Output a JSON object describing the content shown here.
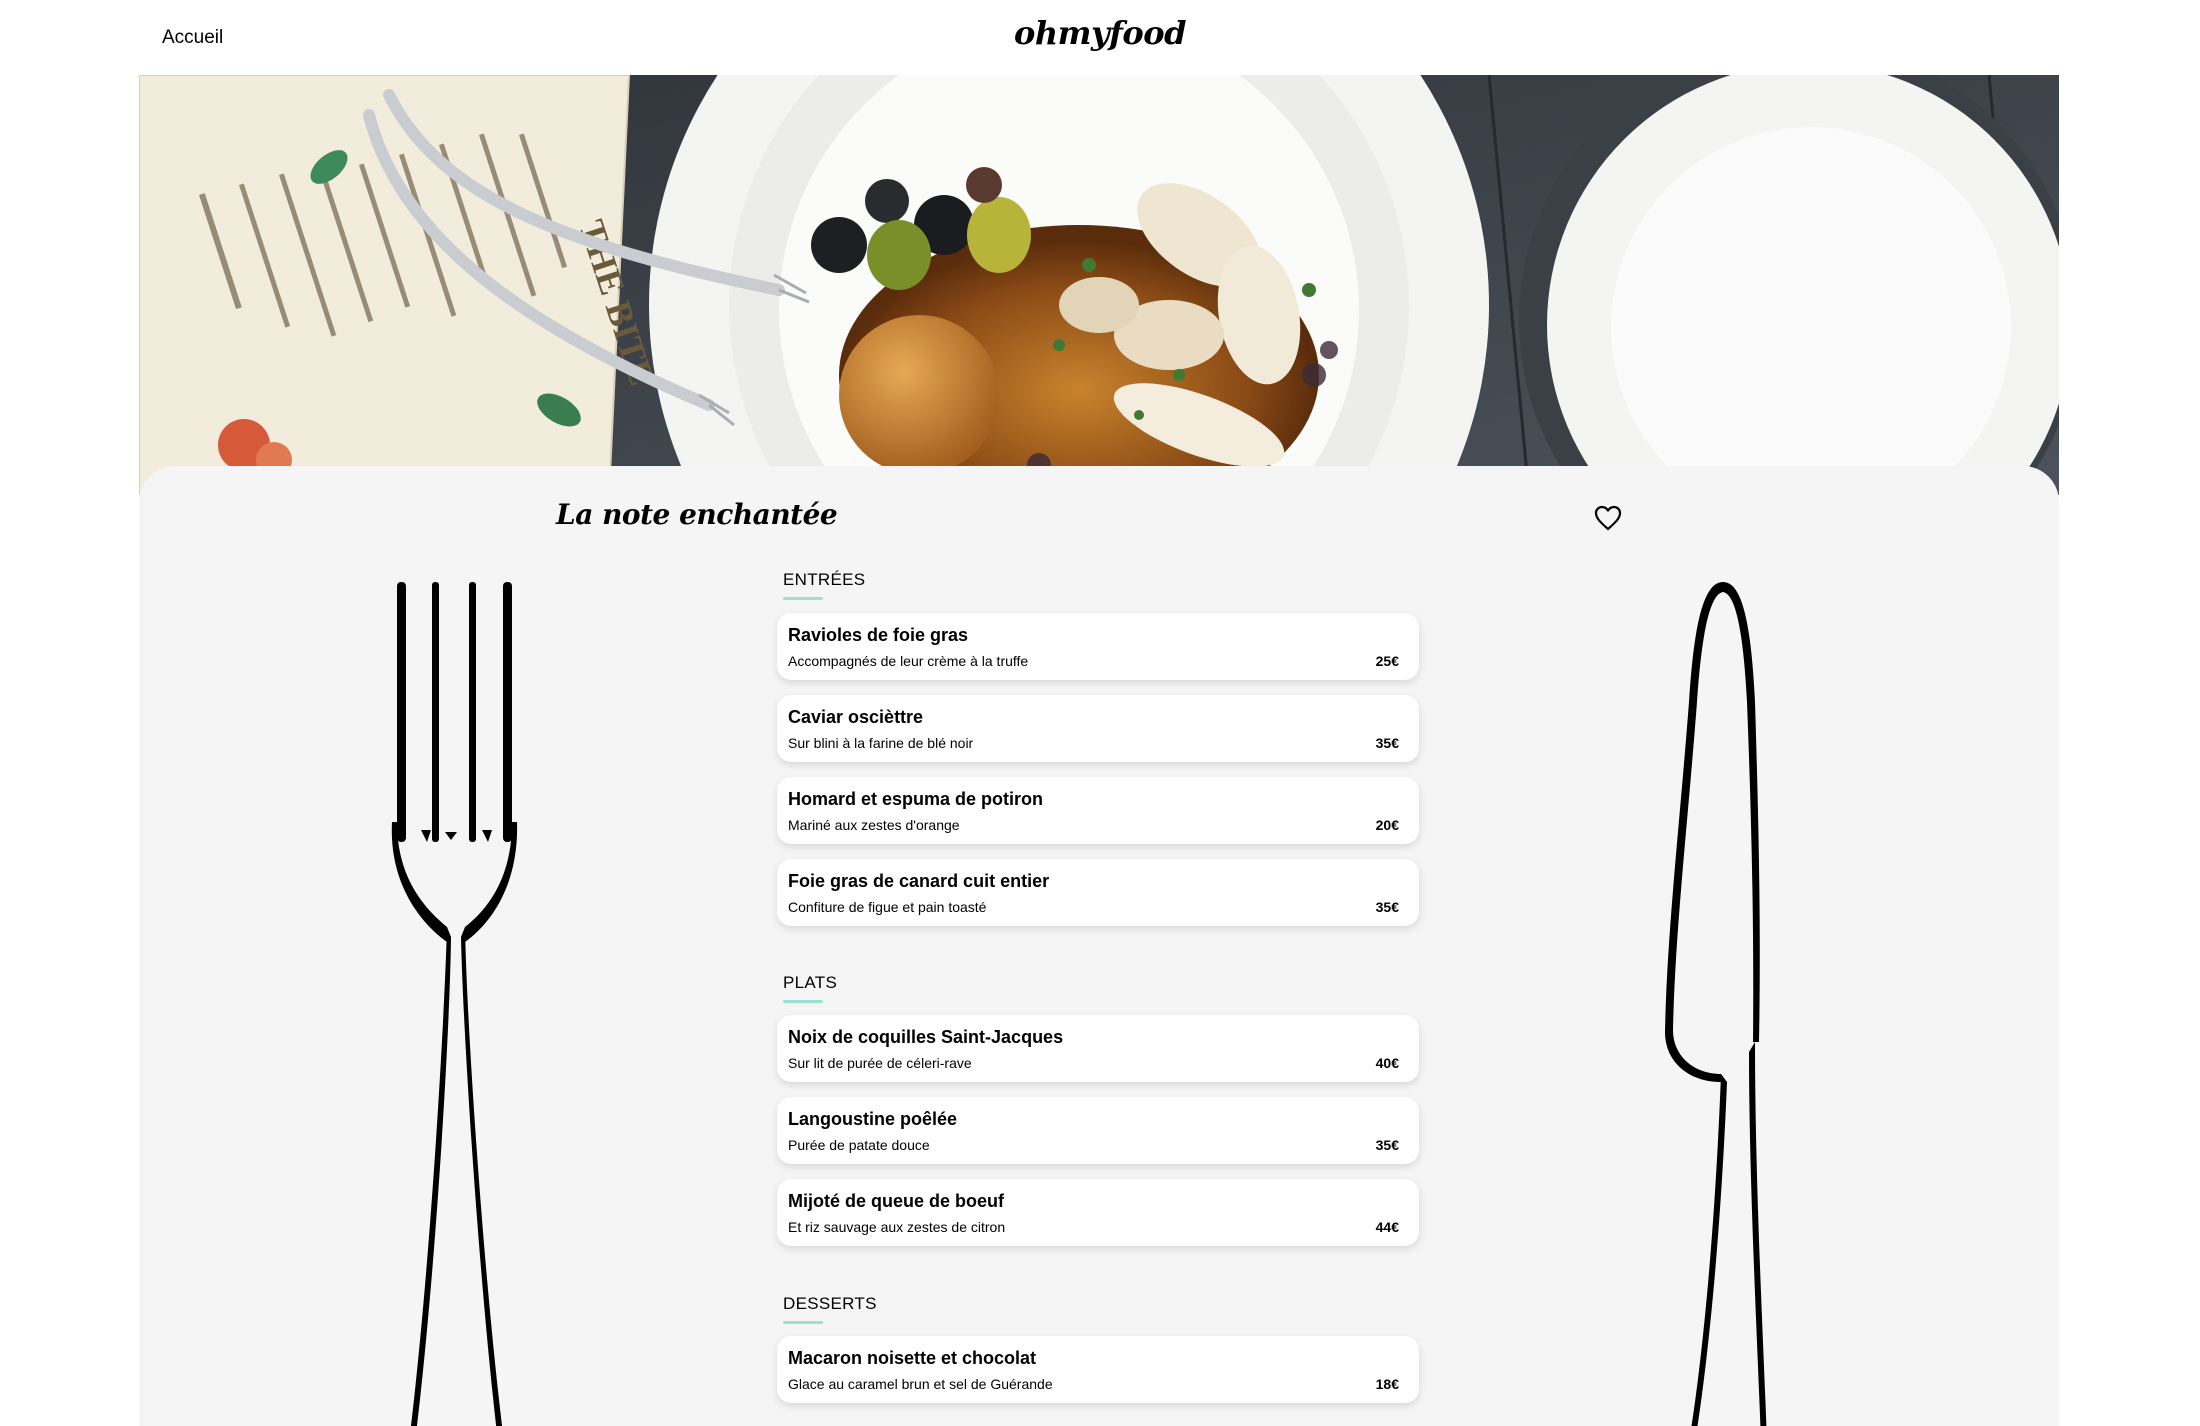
{
  "header": {
    "nav_home": "Accueil",
    "logo": "ohmyfood"
  },
  "hero": {
    "image_description": "Overhead photo of a plate with olives, arancini and grilled squid next to a menu and an empty plate",
    "menu_text": "THE BITE"
  },
  "restaurant": {
    "name": "La note enchantée",
    "favorite_icon": "heart-icon",
    "accent_color": "#99e2d0"
  },
  "menu": {
    "sections": [
      {
        "title": "ENTRÉES",
        "dishes": [
          {
            "name": "Ravioles de foie gras",
            "desc": "Accompagnés de leur crème à la truffe",
            "price": "25€"
          },
          {
            "name": "Caviar oscièttre",
            "desc": "Sur blini à la farine de blé noir",
            "price": "35€"
          },
          {
            "name": "Homard et espuma de potiron",
            "desc": "Mariné aux zestes d'orange",
            "price": "20€"
          },
          {
            "name": "Foie gras de canard cuit entier",
            "desc": "Confiture de figue et pain toasté",
            "price": "35€"
          }
        ]
      },
      {
        "title": "PLATS",
        "dishes": [
          {
            "name": "Noix de coquilles Saint-Jacques",
            "desc": "Sur lit de purée de céleri-rave",
            "price": "40€"
          },
          {
            "name": "Langoustine poêlée",
            "desc": "Purée de patate douce",
            "price": "35€"
          },
          {
            "name": "Mijoté de queue de boeuf",
            "desc": "Et riz sauvage aux zestes de citron",
            "price": "44€"
          }
        ]
      },
      {
        "title": "DESSERTS",
        "dishes": [
          {
            "name": "Macaron noisette et chocolat",
            "desc": "Glace au caramel brun et sel de Guérande",
            "price": "18€"
          }
        ]
      }
    ]
  }
}
